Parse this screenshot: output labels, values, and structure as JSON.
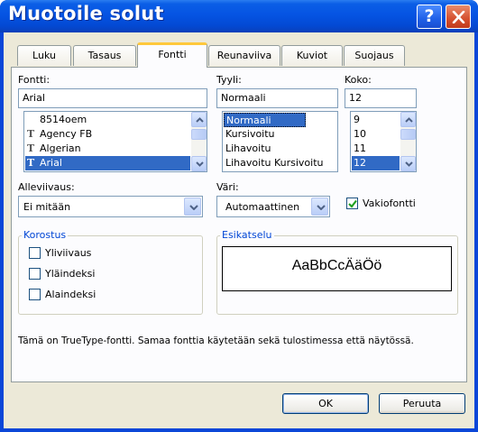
{
  "window": {
    "title": "Muotoile solut",
    "help_icon": "help-icon",
    "close_icon": "close-icon"
  },
  "tabs": [
    {
      "label": "Luku"
    },
    {
      "label": "Tasaus"
    },
    {
      "label": "Fontti",
      "active": true
    },
    {
      "label": "Reunaviiva"
    },
    {
      "label": "Kuviot"
    },
    {
      "label": "Suojaus"
    }
  ],
  "font": {
    "label": "Fontti:",
    "value": "Arial",
    "items": [
      {
        "label": "8514oem",
        "truetype": false
      },
      {
        "label": "Agency FB",
        "truetype": true
      },
      {
        "label": "Algerian",
        "truetype": true
      },
      {
        "label": "Arial",
        "truetype": true,
        "selected": true
      }
    ]
  },
  "style": {
    "label": "Tyyli:",
    "value": "Normaali",
    "items": [
      {
        "label": "Normaali",
        "selected": true
      },
      {
        "label": "Kursivoitu"
      },
      {
        "label": "Lihavoitu"
      },
      {
        "label": "Lihavoitu Kursivoitu"
      }
    ]
  },
  "size": {
    "label": "Koko:",
    "value": "12",
    "items": [
      {
        "label": "9"
      },
      {
        "label": "10"
      },
      {
        "label": "11"
      },
      {
        "label": "12",
        "selected": true
      }
    ]
  },
  "underline": {
    "label": "Alleviivaus:",
    "value": "Ei mitään"
  },
  "color": {
    "label": "Väri:",
    "value": "Automaattinen"
  },
  "normal_font": {
    "label": "Vakiofontti",
    "checked": true
  },
  "effects": {
    "title": "Korostus",
    "items": [
      {
        "label": "Yliviivaus",
        "checked": false
      },
      {
        "label": "Yläindeksi",
        "checked": false
      },
      {
        "label": "Alaindeksi",
        "checked": false
      }
    ]
  },
  "preview": {
    "title": "Esikatselu",
    "sample": "AaBbCcÄäÖö"
  },
  "info_text": "Tämä on TrueType-fontti. Samaa fonttia käytetään sekä tulostimessa että näytössä.",
  "buttons": {
    "ok": "OK",
    "cancel": "Peruuta"
  },
  "colors": {
    "titlebar": "#0554e3",
    "dialog_bg": "#ece9d8",
    "selection": "#316ac5",
    "group_title": "#0046d5",
    "active_tab_accent": "#ffc83c"
  }
}
